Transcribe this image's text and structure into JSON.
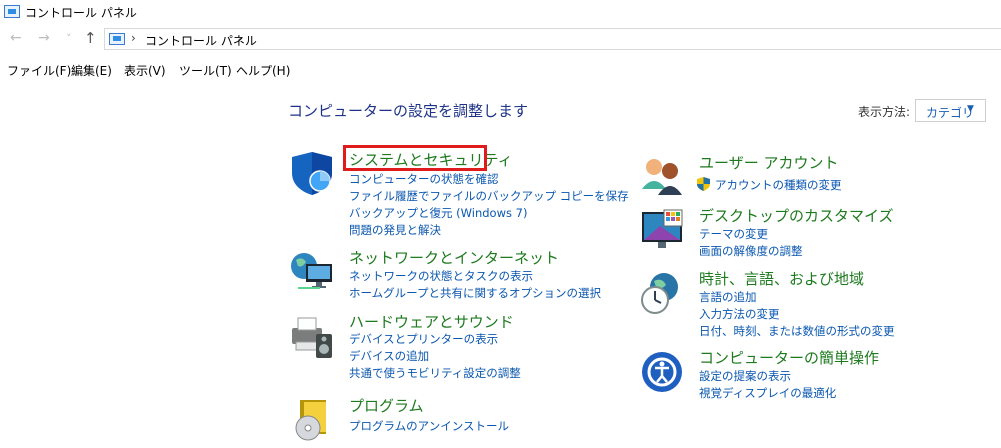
{
  "window": {
    "title": "コントロール パネル"
  },
  "nav": {
    "back": "←",
    "forward": "→",
    "recent": "˅",
    "up": "↑"
  },
  "address": {
    "sep1": "›",
    "crumb": "コントロール パネル",
    "sep2": "›"
  },
  "menu": [
    "ファイル(F)",
    "編集(E)",
    "表示(V)",
    "ツール(T)",
    "ヘルプ(H)"
  ],
  "header": "コンピューターの設定を調整します",
  "view": {
    "label": "表示方法:",
    "value": "カテゴリ",
    "caret": "▼"
  },
  "left": [
    {
      "title": "システムとセキュリティ",
      "links": [
        "コンピューターの状態を確認",
        "ファイル履歴でファイルのバックアップ コピーを保存",
        "バックアップと復元 (Windows 7)",
        "問題の発見と解決"
      ]
    },
    {
      "title": "ネットワークとインターネット",
      "links": [
        "ネットワークの状態とタスクの表示",
        "ホームグループと共有に関するオプションの選択"
      ]
    },
    {
      "title": "ハードウェアとサウンド",
      "links": [
        "デバイスとプリンターの表示",
        "デバイスの追加",
        "共通で使うモビリティ設定の調整"
      ]
    },
    {
      "title": "プログラム",
      "links": [
        "プログラムのアンインストール"
      ]
    }
  ],
  "right": [
    {
      "title": "ユーザー アカウント",
      "links": [
        "アカウントの種類の変更"
      ]
    },
    {
      "title": "デスクトップのカスタマイズ",
      "links": [
        "テーマの変更",
        "画面の解像度の調整"
      ]
    },
    {
      "title": "時計、言語、および地域",
      "links": [
        "言語の追加",
        "入力方法の変更",
        "日付、時刻、または数値の形式の変更"
      ]
    },
    {
      "title": "コンピューターの簡単操作",
      "links": [
        "設定の提案の表示",
        "視覚ディスプレイの最適化"
      ]
    }
  ]
}
